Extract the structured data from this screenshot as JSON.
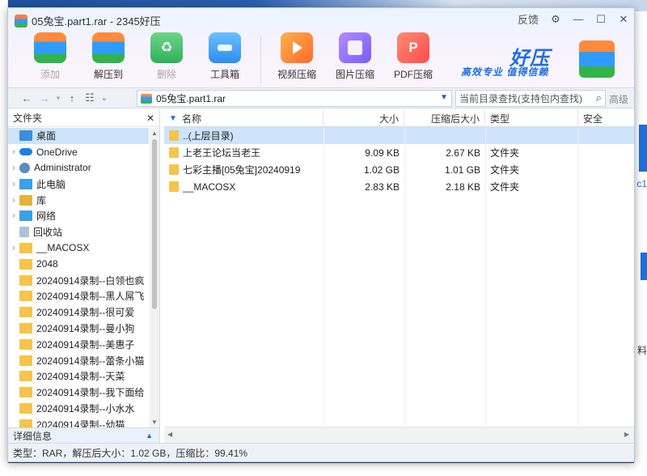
{
  "window": {
    "title": "05兔宝.part1.rar - 2345好压",
    "feedback": "反馈",
    "settings_icon": "gear-icon",
    "minimize_icon": "minimize-icon",
    "maximize_icon": "maximize-icon",
    "close_icon": "close-icon"
  },
  "toolbar": {
    "add": "添加",
    "extract": "解压到",
    "delete": "删除",
    "toolbox": "工具箱",
    "video": "视频压缩",
    "image": "图片压缩",
    "pdf": "PDF压缩"
  },
  "brand": {
    "title": "好压",
    "slogan": "高效专业  值得信赖"
  },
  "nav": {
    "address": "05兔宝.part1.rar",
    "search_placeholder": "当前目录查找(支持包内查找)",
    "advanced": "高级"
  },
  "sidebar": {
    "header": "文件夹",
    "close": "✕",
    "items": [
      {
        "label": "桌面",
        "icon": "desktop-icon",
        "expandable": false,
        "selected": true
      },
      {
        "label": "OneDrive",
        "icon": "cloud-icon",
        "expandable": true
      },
      {
        "label": "Administrator",
        "icon": "user-icon",
        "expandable": true
      },
      {
        "label": "此电脑",
        "icon": "computer-icon",
        "expandable": true
      },
      {
        "label": "库",
        "icon": "library-icon",
        "expandable": true
      },
      {
        "label": "网络",
        "icon": "network-icon",
        "expandable": true
      },
      {
        "label": "回收站",
        "icon": "recycle-bin-icon",
        "expandable": false
      },
      {
        "label": "__MACOSX",
        "icon": "folder-icon",
        "expandable": true
      },
      {
        "label": "2048",
        "icon": "folder-icon",
        "expandable": false
      },
      {
        "label": "20240914录制--白领也疯",
        "icon": "folder-icon",
        "expandable": false
      },
      {
        "label": "20240914录制--黑人屌飞",
        "icon": "folder-icon",
        "expandable": false
      },
      {
        "label": "20240914录制--很可爱",
        "icon": "folder-icon",
        "expandable": false
      },
      {
        "label": "20240914录制--曼小狗",
        "icon": "folder-icon",
        "expandable": false
      },
      {
        "label": "20240914录制--美惠子",
        "icon": "folder-icon",
        "expandable": false
      },
      {
        "label": "20240914录制--蕾条小猫",
        "icon": "folder-icon",
        "expandable": false
      },
      {
        "label": "20240914录制--天菜",
        "icon": "folder-icon",
        "expandable": false
      },
      {
        "label": "20240914录制--我下面给",
        "icon": "folder-icon",
        "expandable": false
      },
      {
        "label": "20240914录制--小水水",
        "icon": "folder-icon",
        "expandable": false
      },
      {
        "label": "20240914录制--幼猫",
        "icon": "folder-icon",
        "expandable": false
      }
    ],
    "details": "详细信息"
  },
  "table": {
    "columns": [
      "名称",
      "大小",
      "压缩后大小",
      "类型",
      "安全"
    ],
    "rows": [
      {
        "name": "..(上层目录)",
        "size": "",
        "compressed": "",
        "type": "",
        "security": ""
      },
      {
        "name": "上老王论坛当老王",
        "size": "9.09 KB",
        "compressed": "2.67 KB",
        "type": "文件夹",
        "security": ""
      },
      {
        "name": "七彩主播[05兔宝]20240919",
        "size": "1.02 GB",
        "compressed": "1.01 GB",
        "type": "文件夹",
        "security": ""
      },
      {
        "name": "__MACOSX",
        "size": "2.83 KB",
        "compressed": "2.18 KB",
        "type": "文件夹",
        "security": ""
      }
    ]
  },
  "status": "类型：RAR，解压后大小：1.02 GB，压缩比：99.41%",
  "background": {
    "right_text_1": "c1",
    "right_text_2": "料"
  },
  "colors": {
    "accent": "#1e6fd9",
    "selection": "#cde4fb",
    "folder": "#f5c44a"
  }
}
